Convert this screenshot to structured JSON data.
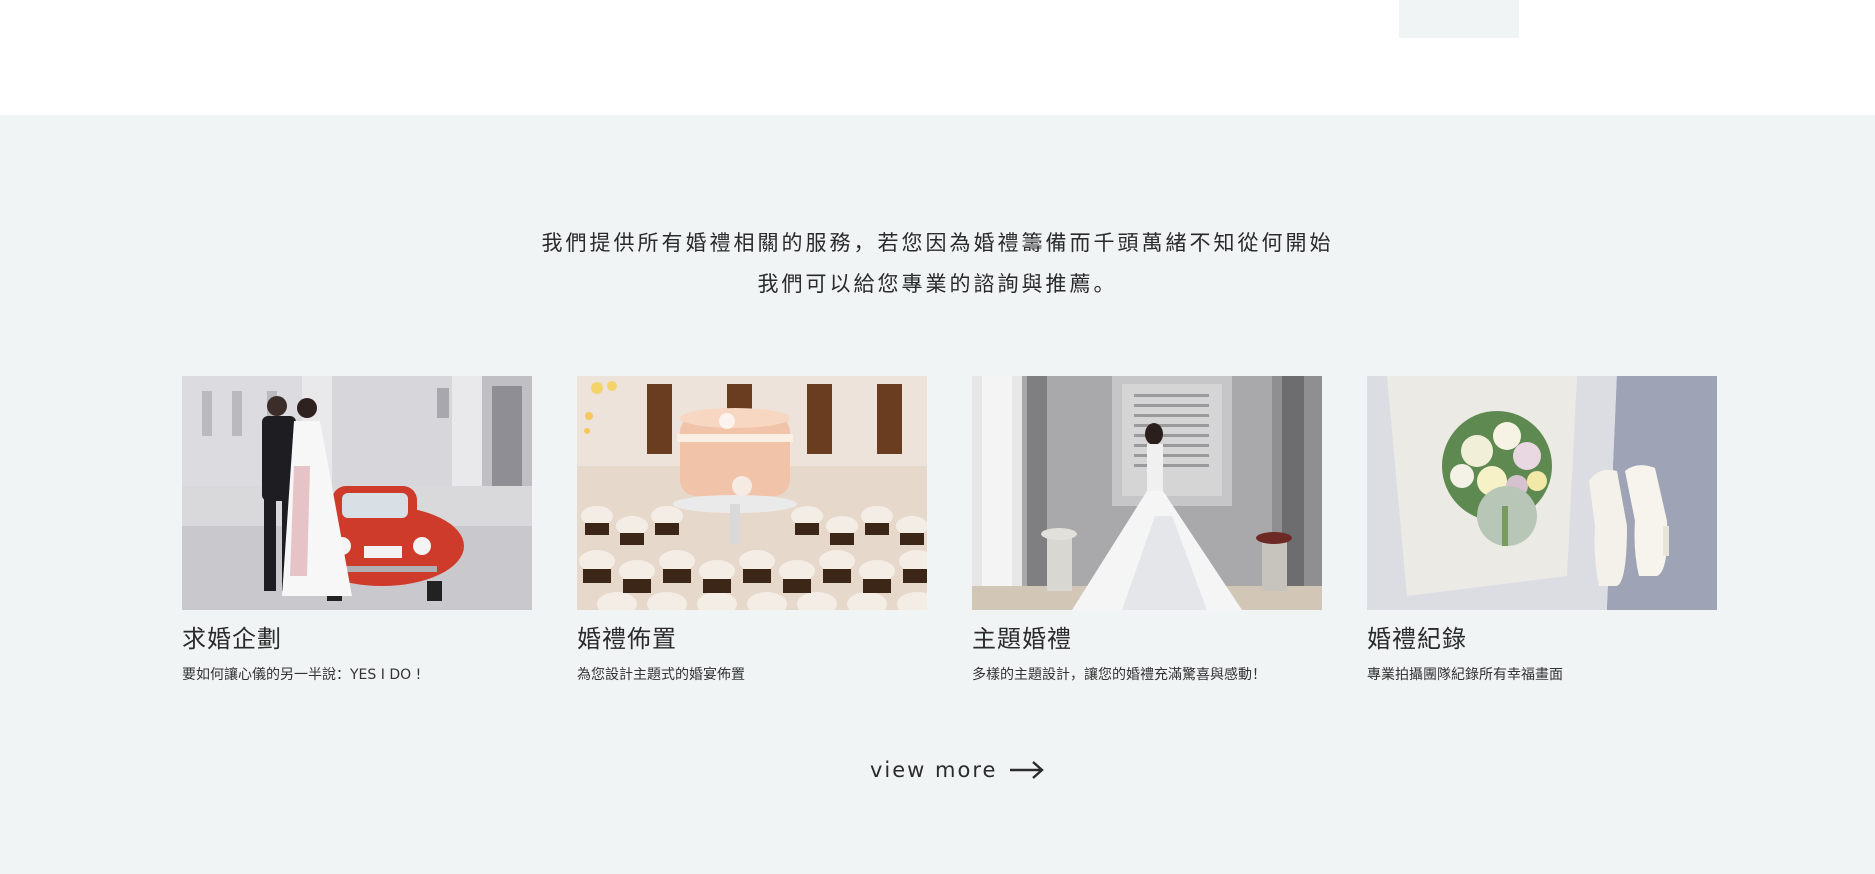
{
  "intro": {
    "line1": "我們提供所有婚禮相關的服務，若您因為婚禮籌備而千頭萬緒不知從何開始",
    "line2": "我們可以給您專業的諮詢與推薦。"
  },
  "services": [
    {
      "title": "求婚企劃",
      "desc": "要如何讓心儀的另一半說：YES I DO !",
      "image": "couple-with-red-car-photo"
    },
    {
      "title": "婚禮佈置",
      "desc": "為您設計主題式的婚宴佈置",
      "image": "wedding-cake-cupcakes-photo"
    },
    {
      "title": "主題婚禮",
      "desc": "多樣的主題設計，讓您的婚禮充滿驚喜與感動！",
      "image": "bride-in-gown-photo"
    },
    {
      "title": "婚禮紀錄",
      "desc": "專業拍攝團隊紀錄所有幸福畫面",
      "image": "bouquet-and-shoes-photo"
    }
  ],
  "view_more": {
    "label": "view more",
    "icon": "arrow-right-icon"
  },
  "colors": {
    "section_bg": "#f1f4f5",
    "text": "#333333"
  }
}
